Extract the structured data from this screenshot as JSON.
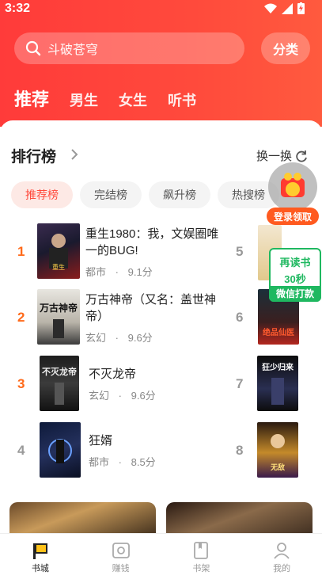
{
  "status": {
    "time": "3:32"
  },
  "search": {
    "placeholder": "斗破苍穹"
  },
  "header": {
    "category_label": "分类"
  },
  "top_tabs": [
    {
      "label": "推荐",
      "active": true
    },
    {
      "label": "男生"
    },
    {
      "label": "女生"
    },
    {
      "label": "听书"
    }
  ],
  "ranking": {
    "title": "排行榜",
    "refresh_label": "换一换",
    "pills": [
      {
        "label": "推荐榜",
        "active": true
      },
      {
        "label": "完结榜"
      },
      {
        "label": "飙升榜"
      },
      {
        "label": "热搜榜"
      }
    ],
    "left_books": [
      {
        "rank": "1",
        "title": "重生1980：我，文娱圈唯一的BUG!",
        "genre": "都市",
        "dot": "·",
        "score": "9.1分"
      },
      {
        "rank": "2",
        "title": "万古神帝（又名：盖世神帝）",
        "genre": "玄幻",
        "dot": "·",
        "score": "9.6分"
      },
      {
        "rank": "3",
        "title": "不灭龙帝",
        "genre": "玄幻",
        "dot": "·",
        "score": "9.6分"
      },
      {
        "rank": "4",
        "title": "狂婿",
        "genre": "都市",
        "dot": "·",
        "score": "8.5分"
      }
    ],
    "right_books": [
      {
        "rank": "5"
      },
      {
        "rank": "6"
      },
      {
        "rank": "7"
      },
      {
        "rank": "8"
      }
    ]
  },
  "floating": {
    "login_label": "登录领取",
    "read_line1": "再读书",
    "read_line2": "30秒",
    "read_line3": "微信打款"
  },
  "bottom_nav": [
    {
      "label": "书城",
      "active": true
    },
    {
      "label": "赚钱"
    },
    {
      "label": "书架"
    },
    {
      "label": "我的"
    }
  ],
  "colors": {
    "brand": "#ff4a3c",
    "rank_hot": "#ff6a1a",
    "green": "#1fb860"
  }
}
